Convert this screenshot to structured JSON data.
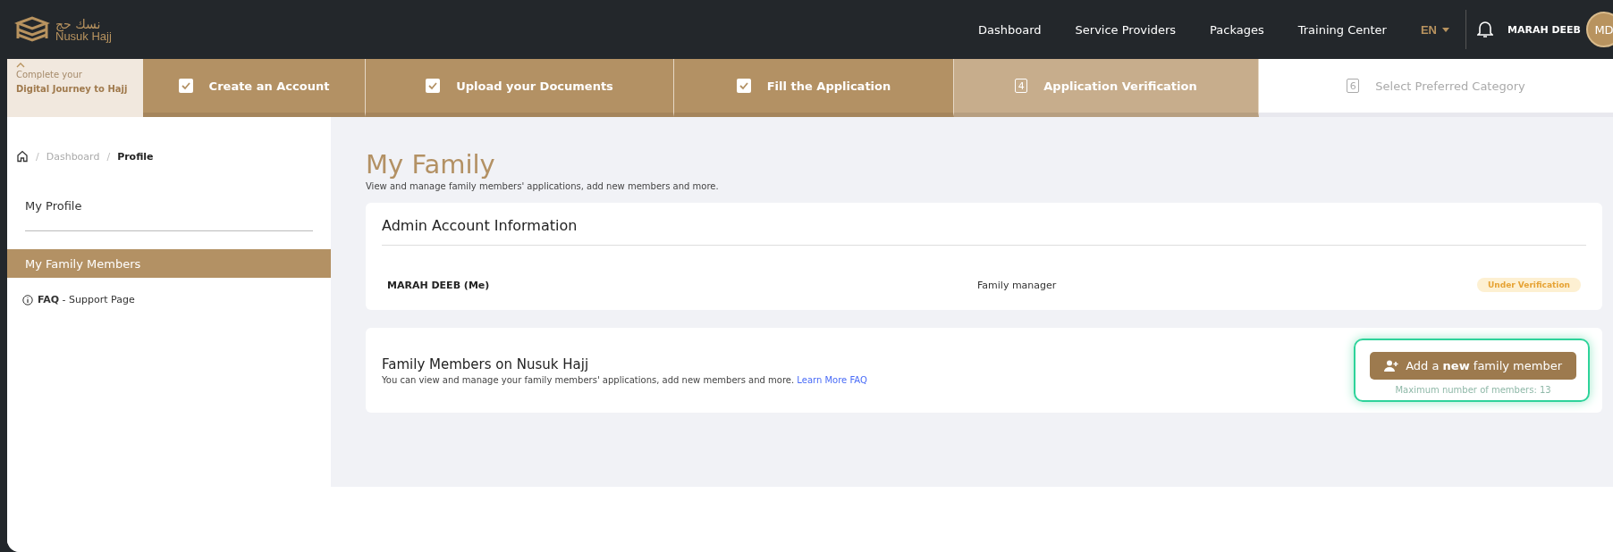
{
  "header": {
    "logo_arabic": "نسك حج",
    "logo_text": "Nusuk Hajj",
    "nav": [
      {
        "label": "Dashboard"
      },
      {
        "label": "Service Providers"
      },
      {
        "label": "Packages"
      },
      {
        "label": "Training Center"
      }
    ],
    "language": "EN",
    "user_name": "MARAH DEEB",
    "avatar_initials": "MD"
  },
  "journey": {
    "line1": "Complete your",
    "line2": "Digital Journey to Hajj",
    "steps": [
      {
        "label": "Create an Account",
        "checked": true,
        "selected": false
      },
      {
        "label": "Upload your Documents",
        "checked": true,
        "selected": false
      },
      {
        "label": "Fill the Application",
        "checked": true,
        "selected": false
      },
      {
        "label": "Application Verification",
        "checked": false,
        "selected": true,
        "number": "4"
      },
      {
        "label": "Select Preferred Category",
        "checked": false,
        "selected": false,
        "number": "6"
      }
    ]
  },
  "breadcrumb": [
    {
      "separator": "/",
      "label": "Dashboard"
    },
    {
      "separator": "/",
      "label": "Profile"
    }
  ],
  "sidebar": {
    "items": [
      {
        "label": "My Profile",
        "selected": false
      },
      {
        "label": "My Family Members",
        "selected": true
      }
    ],
    "faq_bold": "FAQ",
    "faq_text": " - Support Page"
  },
  "page": {
    "title": "My Family",
    "subtitle": "View and manage family members' applications, add new members and more."
  },
  "admin_card": {
    "title": "Admin Account Information",
    "name": "MARAH DEEB (Me)",
    "role": "Family manager",
    "status": "Under Verification"
  },
  "members_card": {
    "title": "Family Members on Nusuk Hajj",
    "description": "You can view and manage your family members' applications, add new members and more.",
    "link": "Learn More FAQ",
    "button": "Add a **new** family member",
    "max_note": "Maximum number of members: 13"
  }
}
